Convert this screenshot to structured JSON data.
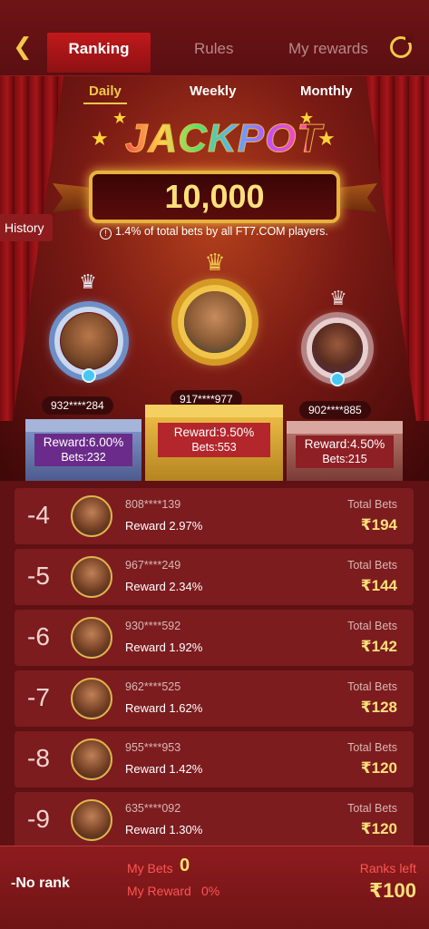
{
  "header": {
    "tabs": [
      {
        "label": "Ranking",
        "active": true
      },
      {
        "label": "Rules",
        "active": false
      },
      {
        "label": "My rewards",
        "active": false
      }
    ],
    "back_icon": "back-arrow-icon",
    "refresh_icon": "refresh-icon"
  },
  "periods": [
    {
      "label": "Daily",
      "active": true
    },
    {
      "label": "Weekly",
      "active": false
    },
    {
      "label": "Monthly",
      "active": false
    }
  ],
  "jackpot": {
    "title": "JACKPOT",
    "amount": "10,000",
    "note": "1.4% of total bets by all FT7.COM players."
  },
  "history_label": "History",
  "podium": [
    {
      "position": 2,
      "phone": "932****284",
      "reward": "Reward:6.00%",
      "bets": "Bets:232"
    },
    {
      "position": 1,
      "phone": "917****977",
      "reward": "Reward:9.50%",
      "bets": "Bets:553"
    },
    {
      "position": 3,
      "phone": "902****885",
      "reward": "Reward:4.50%",
      "bets": "Bets:215"
    }
  ],
  "ranks": [
    {
      "rank": "-4",
      "uid": "808****139",
      "reward": "Reward 2.97%",
      "total_label": "Total Bets",
      "total": "₹194"
    },
    {
      "rank": "-5",
      "uid": "967****249",
      "reward": "Reward 2.34%",
      "total_label": "Total Bets",
      "total": "₹144"
    },
    {
      "rank": "-6",
      "uid": "930****592",
      "reward": "Reward 1.92%",
      "total_label": "Total Bets",
      "total": "₹142"
    },
    {
      "rank": "-7",
      "uid": "962****525",
      "reward": "Reward 1.62%",
      "total_label": "Total Bets",
      "total": "₹128"
    },
    {
      "rank": "-8",
      "uid": "955****953",
      "reward": "Reward 1.42%",
      "total_label": "Total Bets",
      "total": "₹120"
    },
    {
      "rank": "-9",
      "uid": "635****092",
      "reward": "Reward 1.30%",
      "total_label": "Total Bets",
      "total": "₹120"
    }
  ],
  "footer": {
    "no_rank": "-No rank",
    "my_bets_label": "My Bets",
    "my_bets_value": "0",
    "my_reward_label": "My Reward",
    "my_reward_value": "0%",
    "ranks_left_label": "Ranks left",
    "ranks_left_value": "₹100"
  },
  "colors": {
    "accent_gold": "#f1c84a",
    "background": "#5a0f12",
    "highlight_red": "#ff5552"
  }
}
